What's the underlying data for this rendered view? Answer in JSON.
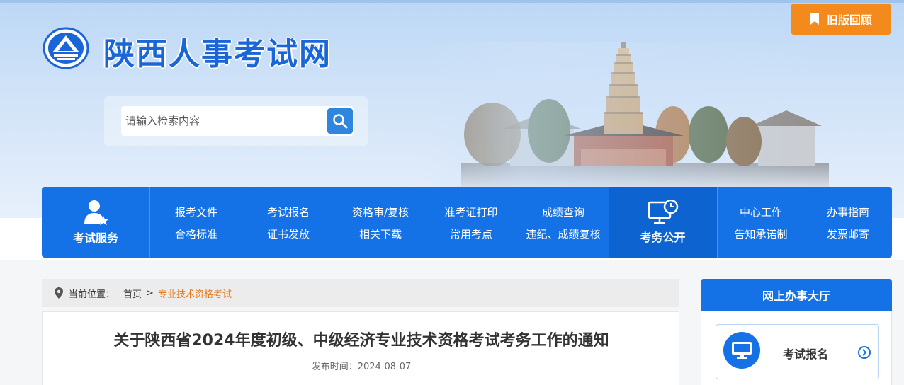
{
  "header": {
    "site_title": "陕西人事考试网",
    "old_version_label": "旧版回顾",
    "search_placeholder": "请输入检索内容"
  },
  "nav": {
    "exam_service_label": "考试服务",
    "affairs_public_label": "考务公开",
    "links_group1": [
      {
        "label": "报考文件"
      },
      {
        "label": "考试报名"
      },
      {
        "label": "资格审/复核"
      },
      {
        "label": "准考证打印"
      },
      {
        "label": "成绩查询"
      },
      {
        "label": "合格标准"
      },
      {
        "label": "证书发放"
      },
      {
        "label": "相关下载"
      },
      {
        "label": "常用考点"
      },
      {
        "label": "违纪、成绩复核"
      }
    ],
    "links_group2": [
      {
        "label": "中心工作"
      },
      {
        "label": "办事指南"
      },
      {
        "label": "告知承诺制"
      },
      {
        "label": "发票邮寄"
      }
    ]
  },
  "breadcrumb": {
    "prefix": "当前位置：",
    "home": "首页",
    "separator": ">",
    "current": "专业技术资格考试"
  },
  "article": {
    "title": "关于陕西省2024年度初级、中级经济专业技术资格考试考务工作的通知",
    "date_label": "发布时间：",
    "date": "2024-08-07"
  },
  "sidebar": {
    "heading": "网上办事大厅",
    "item_label": "考试报名"
  },
  "colors": {
    "primary": "#1471e6",
    "accent": "#f48a1b",
    "breadcrumb_current": "#e8761a"
  }
}
